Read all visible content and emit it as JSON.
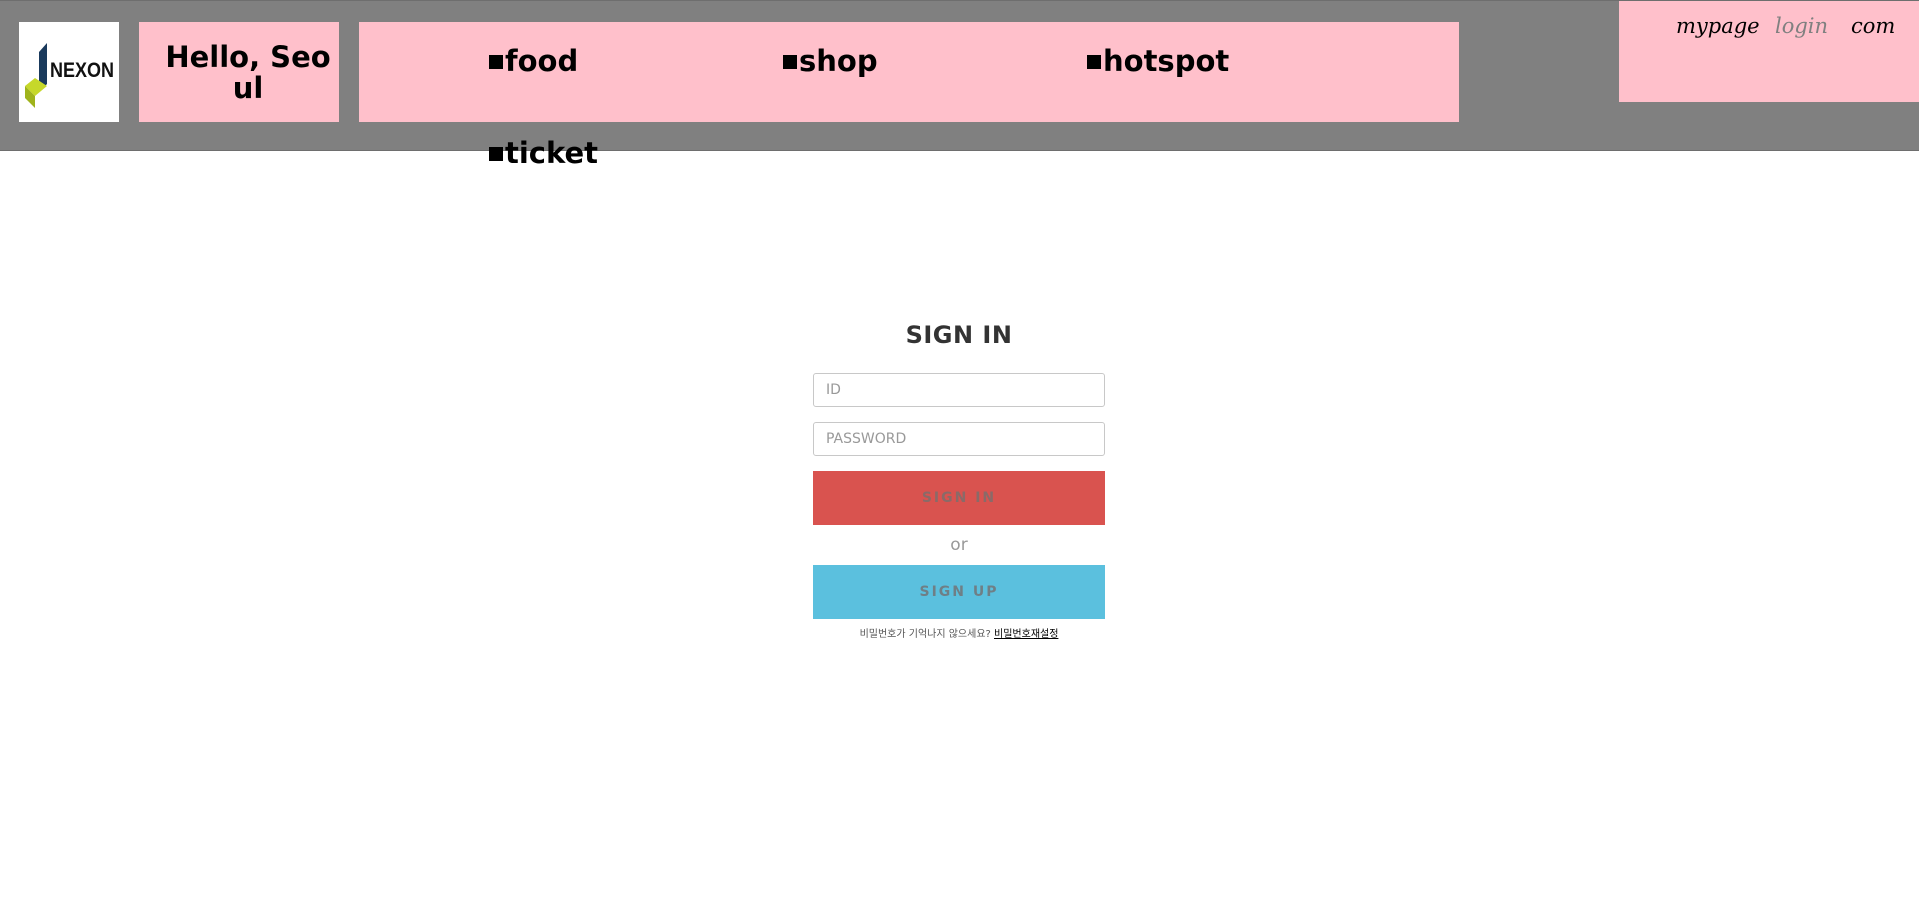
{
  "header": {
    "logo_text": "NEXON",
    "hello": "Hello, Seoul",
    "nav": [
      {
        "label": "food"
      },
      {
        "label": "shop"
      },
      {
        "label": "hotspot"
      },
      {
        "label": "ticket"
      }
    ],
    "links": {
      "mypage": "mypage",
      "login": "login",
      "com": "com"
    }
  },
  "signin": {
    "title": "SIGN IN",
    "id_placeholder": "ID",
    "password_placeholder": "PASSWORD",
    "signin_label": "SIGN IN",
    "or_label": "or",
    "signup_label": "SIGN UP",
    "forgot_text": "비밀번호가 기억나지 않으세요?",
    "reset_link": "비밀번호재설정"
  },
  "colors": {
    "header_bg": "#808080",
    "pink": "#ffc0cb",
    "signin_button": "#d9534f",
    "signup_button": "#5bc0de"
  }
}
